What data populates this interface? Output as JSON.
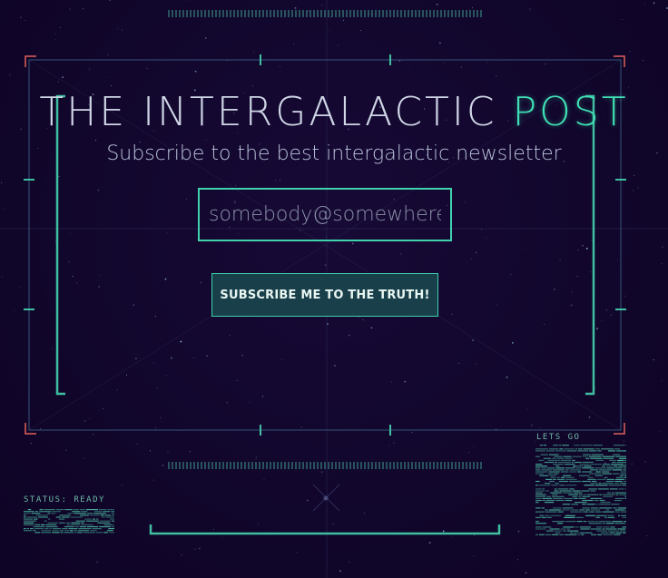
{
  "header": {
    "title_main": "THE INTERGALACTIC ",
    "title_accent": "POST",
    "subtitle": "Subscribe to the best intergalactic newsletter"
  },
  "form": {
    "email_placeholder": "somebody@somewhere",
    "subscribe_label": "SUBSCRIBE ME TO THE TRUTH!"
  },
  "hud": {
    "status_text": "STATUS: READY",
    "action_text": "LETS GO"
  },
  "colors": {
    "background": "#10052a",
    "accent": "#3fe0b4",
    "frame_line": "#3a5a78",
    "corner_red": "#e0605a"
  }
}
